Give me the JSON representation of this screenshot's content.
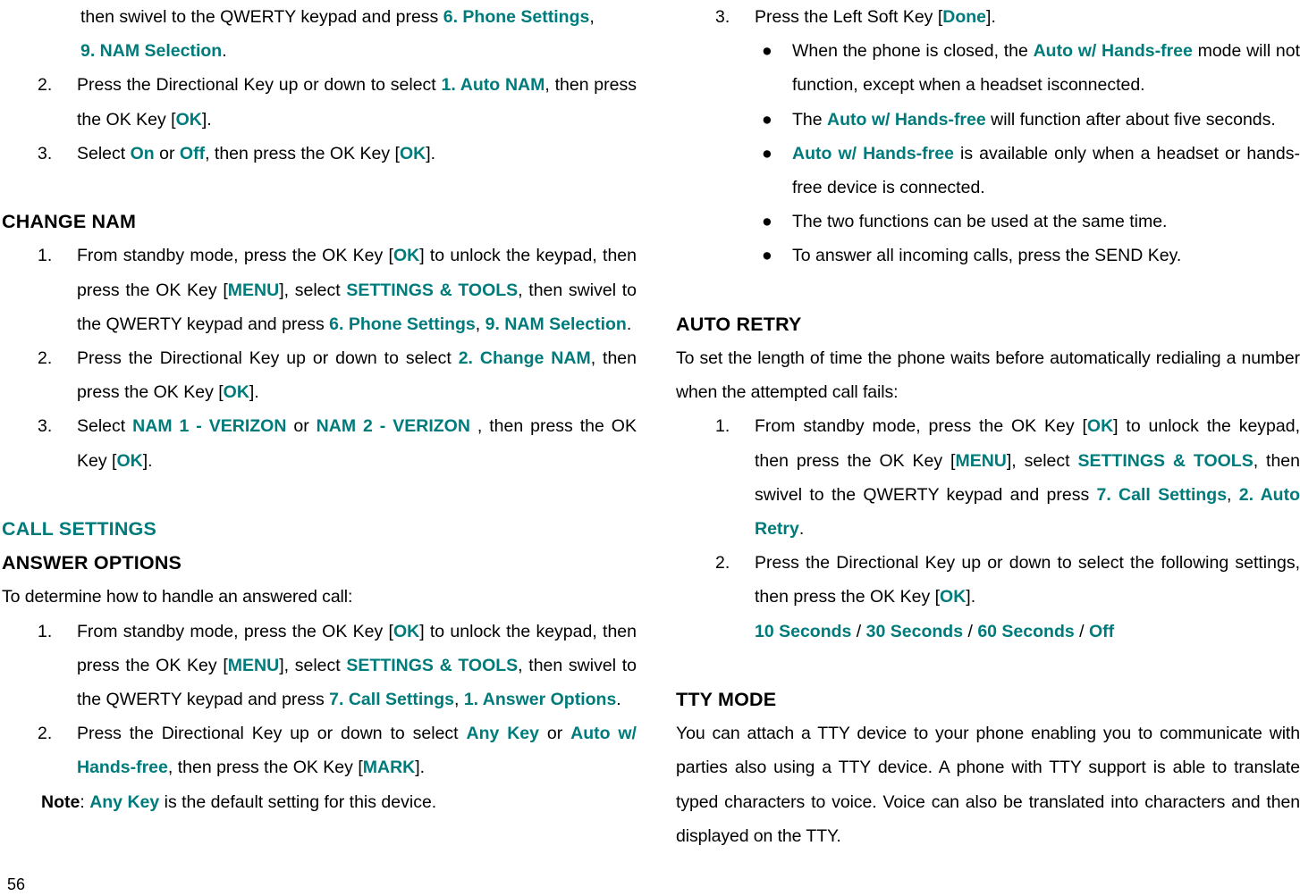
{
  "page": {
    "number": "56",
    "accent_color": "#007b7b",
    "text_color": "#000000",
    "background": "#ffffff"
  },
  "left_column": {
    "auto_nam_continued": {
      "step1_tail_a": "then swivel to the QWERTY keypad and press ",
      "step1_tail_a_key": "6. Phone Settings",
      "step1_tail_comma": ",",
      "step1_tail_b_key": "9. NAM Selection",
      "step1_tail_period": ".",
      "step2": {
        "num": "2.",
        "t1": "Press the Directional Key up or down to select ",
        "k1": "1. Auto NAM",
        "t2": ", then press the OK Key [",
        "k2": "OK",
        "t3": "]."
      },
      "step3": {
        "num": "3.",
        "t1": "Select ",
        "k1": "On",
        "t2": " or ",
        "k2": "Off",
        "t3": ", then press the OK Key [",
        "k3": "OK",
        "t4": "]."
      }
    },
    "change_nam": {
      "heading": "CHANGE NAM",
      "step1": {
        "num": "1.",
        "t1": "From standby mode, press the OK Key [",
        "k1": "OK",
        "t2": "] to unlock the keypad, then press the OK Key [",
        "k2": "MENU",
        "t3": "], select ",
        "k3": "SETTINGS & TOOLS",
        "t4": ", then swivel to the QWERTY keypad and press ",
        "k4": "6. Phone Settings",
        "t5": ", ",
        "k5": "9. NAM Selection",
        "t6": "."
      },
      "step2": {
        "num": "2.",
        "t1": "Press the Directional Key up or down to select ",
        "k1": "2. Change NAM",
        "t2": ", then press the OK Key [",
        "k2": "OK",
        "t3": "]."
      },
      "step3": {
        "num": "3.",
        "t1": "Select ",
        "k1": "NAM 1 - VERIZON",
        "t2": " or ",
        "k2": "NAM 2 - VERIZON",
        "t3": " , then press the OK Key [",
        "k3": "OK",
        "t4": "]."
      }
    },
    "call_settings": {
      "heading": "CALL SETTINGS",
      "answer_options": {
        "heading": "ANSWER OPTIONS",
        "intro": "To determine how to handle an answered call:",
        "step1": {
          "num": "1.",
          "t1": "From standby mode, press the OK Key [",
          "k1": "OK",
          "t2": "] to unlock the keypad, then press the OK Key [",
          "k2": "MENU",
          "t3": "], select ",
          "k3": "SETTINGS & TOOLS",
          "t4": ", then swivel to the QWERTY keypad and press ",
          "k4": "7. Call Settings",
          "t5": ", ",
          "k5": "1. Answer Options",
          "t6": "."
        },
        "step2": {
          "num": "2.",
          "t1": "Press the Directional Key up or down to select ",
          "k1": "Any Key",
          "t2": " or ",
          "k2": "Auto w/ Hands-free",
          "t3": ", then press the OK Key [",
          "k3": "MARK",
          "t4": "]."
        },
        "note": {
          "label": "Note",
          "t1": ": ",
          "k1": "Any Key",
          "t2": " is the default setting for this device."
        }
      }
    }
  },
  "right_column": {
    "answer_options_continued": {
      "step3": {
        "num": "3.",
        "t1": "Press the Left Soft Key [",
        "k1": "Done",
        "t2": "]."
      },
      "bullets": [
        {
          "t1": "When the phone is closed, the ",
          "k1": "Auto w/ Hands-free",
          "t2": " mode will not function, except when a headset isconnected."
        },
        {
          "t1": "The ",
          "k1": "Auto w/ Hands-free",
          "t2": " will function after about five seconds."
        },
        {
          "t1": "",
          "k1": "Auto w/ Hands-free",
          "t2": " is available only when a headset or hands-free device is connected."
        },
        {
          "t1": "The two functions can be used at the same time.",
          "k1": "",
          "t2": ""
        },
        {
          "t1": "To answer all incoming calls, press the SEND Key.",
          "k1": "",
          "t2": ""
        }
      ]
    },
    "auto_retry": {
      "heading": "AUTO RETRY",
      "intro": "To set the length of time the phone waits before automatically redialing a number when the attempted call fails:",
      "step1": {
        "num": "1.",
        "t1": "From standby mode, press the OK Key [",
        "k1": "OK",
        "t2": "] to unlock the keypad, then press the OK Key [",
        "k2": "MENU",
        "t3": "], select ",
        "k3": "SETTINGS & TOOLS",
        "t4": ", then swivel to the QWERTY keypad and press ",
        "k4": "7. Call Settings",
        "t5": ", ",
        "k5": "2. Auto Retry",
        "t6": "."
      },
      "step2": {
        "num": "2.",
        "t1": "Press the Directional Key up or down to select the following settings, then press the OK Key [",
        "k1": "OK",
        "t2": "]."
      },
      "options": {
        "o1": "10 Seconds",
        "sep1": " / ",
        "o2": "30 Seconds",
        "sep2": " / ",
        "o3": "60 Seconds",
        "sep3": " / ",
        "o4": "Off"
      }
    },
    "tty_mode": {
      "heading": "TTY MODE",
      "body": "You can attach a TTY device to your phone enabling you to communicate with parties also using a TTY device. A phone with TTY support is able to translate typed characters to voice. Voice can also be translated into characters and then displayed on the TTY."
    }
  }
}
